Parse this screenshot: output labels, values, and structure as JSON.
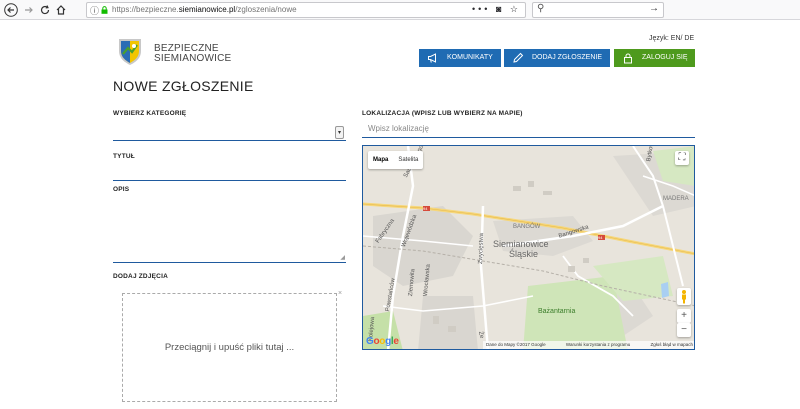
{
  "browser": {
    "url_prefix": "https://bezpieczne.",
    "url_domain": "siemianowice.pl",
    "url_path": "/zgloszenia/nowe",
    "search_placeholder": ""
  },
  "header": {
    "lang_label": "Język:",
    "lang_options": "EN/ DE",
    "brand_line1": "BEZPIECZNE",
    "brand_line2": "SIEMIANOWICE",
    "buttons": {
      "komunikaty": "KOMUNIKATY",
      "dodaj": "DODAJ ZGŁOSZENIE",
      "zaloguj": "ZALOGUJ SIĘ"
    }
  },
  "form": {
    "title": "NOWE ZGŁOSZENIE",
    "category_label": "WYBIERZ KATEGORIĘ",
    "category_value": "",
    "title_label": "TYTUŁ",
    "title_value": "",
    "description_label": "OPIS",
    "description_value": "",
    "photos_label": "DODAJ ZDJĘCIA",
    "dropzone_text": "Przeciągnij i upuść pliki tutaj ...",
    "dropzone_close": "×",
    "location_label": "LOKALIZACJA (WPISZ LUB WYBIERZ NA MAPIE)",
    "location_placeholder": "Wpisz lokalizację"
  },
  "map": {
    "type_map": "Mapa",
    "type_satellite": "Satelita",
    "zoom_in": "+",
    "zoom_out": "−",
    "fullscreen": "⛶",
    "logo": "Google",
    "footer_data": "Dane do Mapy ©2017 Google",
    "footer_terms": "Warunki korzystania z programu",
    "footer_report": "Zgłoś błąd w mapach",
    "labels": {
      "city_line1": "Siemianowice",
      "city_line2": "Śląskie",
      "bangow": "BANGÓW",
      "madera": "MADERA",
      "bazantarnia": "Bażantarnia",
      "road94a": "94",
      "road94b": "94",
      "sadowskiego": "Sadowskiego",
      "fabryczna": "Fabryczna",
      "wojewodzka": "Wojewódzka",
      "zwyciestwa": "Zwycięstwa",
      "bytkowska": "Bytkowska",
      "bangowska": "Bangowska",
      "kolejowa": "Kolejowa",
      "wilsona": "Wilsona",
      "ziemowita": "Ziemowita",
      "powstancow": "Powstańców",
      "wroclawska": "Wrocławska",
      "zeromskiego": "Że"
    }
  }
}
